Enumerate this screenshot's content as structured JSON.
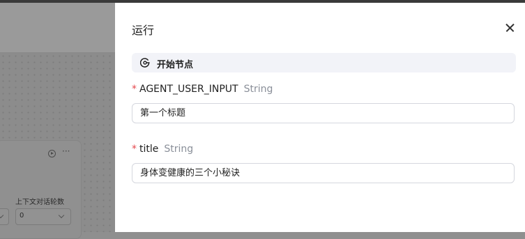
{
  "background": {
    "node": {
      "context_label": "上下文对话轮数",
      "context_value": "0",
      "more_label": "···"
    }
  },
  "drawer": {
    "title": "运行",
    "section_label": "开始节点",
    "fields": [
      {
        "required_mark": "*",
        "name": "AGENT_USER_INPUT",
        "type": "String",
        "value": "第一个标题"
      },
      {
        "required_mark": "*",
        "name": "title",
        "type": "String",
        "value": "身体变健康的三个小秘诀"
      }
    ]
  },
  "icons": {
    "close": "close-icon",
    "section": "start-node-icon",
    "run": "play-circle-icon",
    "more": "more-icon"
  },
  "colors": {
    "required": "#e5484d",
    "type_text": "#8a8f99",
    "section_bg": "#f2f3f8"
  }
}
